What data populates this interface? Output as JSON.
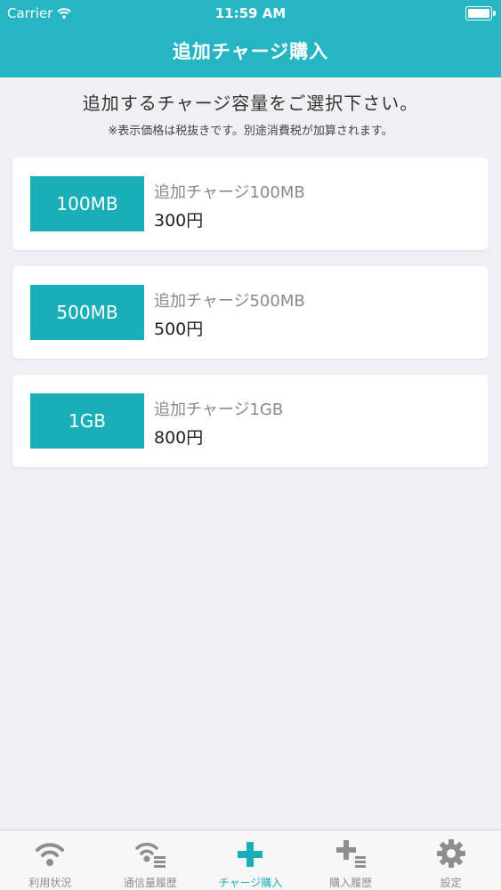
{
  "status_bar": {
    "carrier": "Carrier",
    "time": "11:59 AM"
  },
  "nav": {
    "title": "追加チャージ購入"
  },
  "intro": {
    "main": "追加するチャージ容量をご選択下さい。",
    "note": "※表示価格は税抜きです。別途消費税が加算されます。"
  },
  "options": [
    {
      "badge": "100MB",
      "title": "追加チャージ100MB",
      "price": "300円"
    },
    {
      "badge": "500MB",
      "title": "追加チャージ500MB",
      "price": "500円"
    },
    {
      "badge": "1GB",
      "title": "追加チャージ1GB",
      "price": "800円"
    }
  ],
  "tabs": [
    {
      "label": "利用状況",
      "icon": "wifi-icon"
    },
    {
      "label": "通信量履歴",
      "icon": "wifi-list-icon"
    },
    {
      "label": "チャージ購入",
      "icon": "plus-icon",
      "active": true
    },
    {
      "label": "購入履歴",
      "icon": "plus-list-icon"
    },
    {
      "label": "設定",
      "icon": "gear-icon"
    }
  ],
  "colors": {
    "accent": "#26b5c3",
    "badge": "#1aaeb9",
    "tab_inactive": "#8e8e8e"
  }
}
